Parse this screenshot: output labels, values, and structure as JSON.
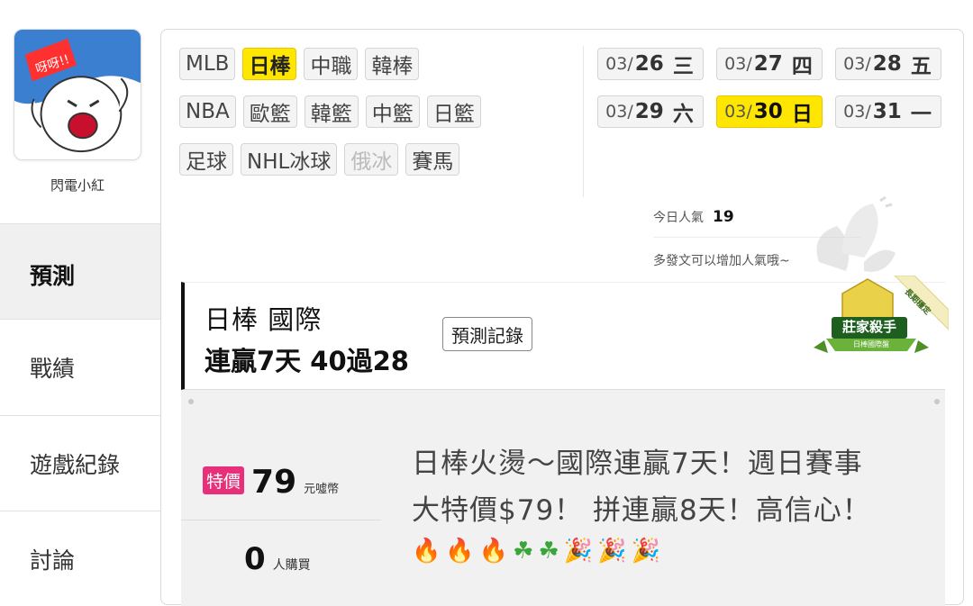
{
  "user": {
    "name": "閃電小紅"
  },
  "nav": [
    {
      "label": "預測",
      "active": true
    },
    {
      "label": "戰績",
      "active": false
    },
    {
      "label": "遊戲紀錄",
      "active": false
    },
    {
      "label": "討論",
      "active": false
    }
  ],
  "leagues": {
    "row1": [
      "MLB",
      "日棒",
      "中職",
      "韓棒"
    ],
    "row2": [
      "NBA",
      "歐籃",
      "韓籃",
      "中籃",
      "日籃"
    ],
    "row3": [
      "足球",
      "NHL冰球",
      "俄冰",
      "賽馬"
    ],
    "active": "日棒",
    "disabled": "俄冰"
  },
  "dates": [
    {
      "prefix": "03/",
      "day": "26",
      "weekday": "三"
    },
    {
      "prefix": "03/",
      "day": "27",
      "weekday": "四"
    },
    {
      "prefix": "03/",
      "day": "28",
      "weekday": "五"
    },
    {
      "prefix": "03/",
      "day": "29",
      "weekday": "六"
    },
    {
      "prefix": "03/",
      "day": "30",
      "weekday": "日",
      "active": true
    },
    {
      "prefix": "03/",
      "day": "31",
      "weekday": "一"
    }
  ],
  "popularity": {
    "label": "今日人氣",
    "value": "19",
    "hint": "多發文可以增加人氣哦~"
  },
  "card": {
    "title": "日棒 國際",
    "streak": "連贏7天 40過28",
    "record_button": "預測記錄",
    "badge": {
      "main": "莊家殺手",
      "sub": "日棒國際盤",
      "ribbon": "長期穩定"
    }
  },
  "offer": {
    "special_label": "特價",
    "price": "79",
    "currency": "元噓幣",
    "buyers": "0",
    "buyers_label": "人購買",
    "text_line1": "日棒火燙～國際連贏7天！週日賽事",
    "text_line2": "大特價$79！ 拼連贏8天！高信心！",
    "emojis": [
      "🔥",
      "🔥",
      "🔥",
      "☘",
      "☘",
      "🎉",
      "🎉",
      "🎉"
    ]
  }
}
